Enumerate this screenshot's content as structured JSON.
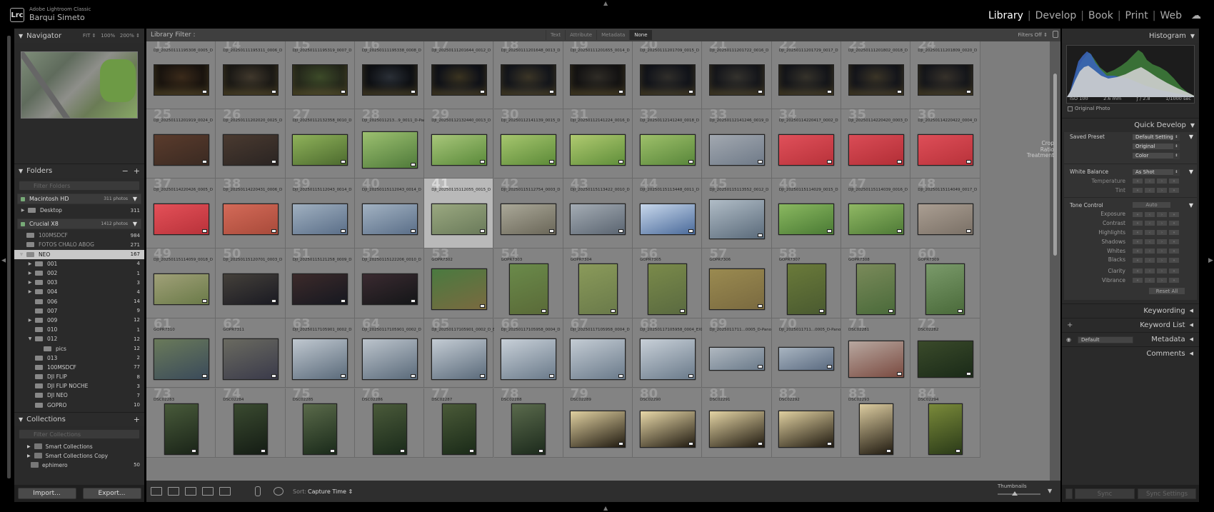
{
  "app": {
    "logo": "Lrc",
    "sub": "Adobe Lightroom Classic",
    "name": "Barqui Simeto"
  },
  "modules": [
    {
      "label": "Library",
      "active": true
    },
    {
      "label": "Develop"
    },
    {
      "label": "Book"
    },
    {
      "label": "Print"
    },
    {
      "label": "Web"
    }
  ],
  "icons": {
    "cloud": "cloud-icon"
  },
  "navigator": {
    "title": "Navigator",
    "zoom": [
      "FIT ⇕",
      "100%",
      "200% ⇕"
    ]
  },
  "folders": {
    "title": "Folders",
    "filter_placeholder": "Filter Folders",
    "volumes": [
      {
        "name": "Macintosh HD",
        "count": "311 photos"
      },
      {
        "name": "Crucial X8",
        "count": "1412 photos"
      }
    ],
    "desktop": {
      "name": "Desktop",
      "count": "311"
    },
    "items": [
      {
        "name": "100MSDCF",
        "count": "984",
        "depth": 0,
        "dim": true
      },
      {
        "name": "FOTOS CHALO ABOG",
        "count": "271",
        "depth": 0,
        "dim": true
      },
      {
        "name": "NEO",
        "count": "167",
        "depth": 0,
        "selected": true,
        "expanded": true
      },
      {
        "name": "001",
        "count": "4",
        "depth": 1,
        "tri": true
      },
      {
        "name": "002",
        "count": "1",
        "depth": 1,
        "tri": true
      },
      {
        "name": "003",
        "count": "3",
        "depth": 1,
        "tri": true
      },
      {
        "name": "004",
        "count": "4",
        "depth": 1,
        "tri": true
      },
      {
        "name": "006",
        "count": "14",
        "depth": 1
      },
      {
        "name": "007",
        "count": "9",
        "depth": 1
      },
      {
        "name": "009",
        "count": "12",
        "depth": 1,
        "tri": true
      },
      {
        "name": "010",
        "count": "1",
        "depth": 1
      },
      {
        "name": "012",
        "count": "12",
        "depth": 1,
        "expanded": true
      },
      {
        "name": "pics",
        "count": "12",
        "depth": 2
      },
      {
        "name": "013",
        "count": "2",
        "depth": 1
      },
      {
        "name": "100MSDCF",
        "count": "77",
        "depth": 1
      },
      {
        "name": "DJI FLIP",
        "count": "8",
        "depth": 1
      },
      {
        "name": "DJI FLIP NOCHE",
        "count": "3",
        "depth": 1
      },
      {
        "name": "DJI NEO",
        "count": "7",
        "depth": 1
      },
      {
        "name": "GOPRO",
        "count": "10",
        "depth": 1
      }
    ]
  },
  "collections": {
    "title": "Collections",
    "filter_placeholder": "Filter Collections",
    "items": [
      {
        "name": "Smart Collections",
        "count": ""
      },
      {
        "name": "Smart Collections Copy",
        "count": ""
      },
      {
        "name": "ephimero",
        "count": "50"
      }
    ]
  },
  "left_buttons": {
    "import": "Import...",
    "export": "Export..."
  },
  "library_filter": {
    "label": "Library Filter :",
    "modes": [
      "Text",
      "Attribute",
      "Metadata",
      "None"
    ],
    "active": "None",
    "status": "Filters Off ⇕"
  },
  "grid_rows": [
    [
      [
        "13",
        "DJI_20250111195308_0005_D"
      ],
      [
        "14",
        "DJI_20250111195311_0006_D"
      ],
      [
        "15",
        "DJI_20250111195319_0007_D"
      ],
      [
        "16",
        "DJI_20250111195338_0008_D"
      ],
      [
        "17",
        "DJI_20250111201644_0012_D"
      ],
      [
        "18",
        "DJI_20250111201648_0013_D"
      ],
      [
        "19",
        "DJI_20250111201655_0014_D"
      ],
      [
        "20",
        "DJI_20250111201709_0015_D"
      ],
      [
        "21",
        "DJI_20250111201722_0016_D"
      ],
      [
        "22",
        "DJI_20250111201729_0017_D"
      ],
      [
        "23",
        "DJI_20250111201802_0018_D"
      ],
      [
        "24",
        "DJI_20250111201809_0020_D"
      ]
    ],
    [
      [
        "25",
        "DJI_20250111201919_0024_D"
      ],
      [
        "26",
        "DJI_20250111202020_0025_D"
      ],
      [
        "27",
        "DJI_20250112132358_0010_D"
      ],
      [
        "28",
        "DJI_2025011213...9_0011_D-Pano"
      ],
      [
        "29",
        "DJI_20250112132440_0013_D"
      ],
      [
        "30",
        "DJI_20250112141139_0015_D"
      ],
      [
        "31",
        "DJI_20250112141224_0016_D"
      ],
      [
        "32",
        "DJI_20250112141240_0018_D"
      ],
      [
        "33",
        "DJI_20250112141246_0019_D"
      ],
      [
        "34",
        "DJI_20250114220417_0002_D"
      ],
      [
        "35",
        "DJI_20250114220420_0003_D"
      ],
      [
        "36",
        "DJI_20250114220422_0004_D"
      ]
    ],
    [
      [
        "37",
        "DJI_20250114220426_0005_D"
      ],
      [
        "38",
        "DJI_20250114220431_0006_D"
      ],
      [
        "39",
        "DJI_20250115112043_0014_D"
      ],
      [
        "40",
        "DJI_20250115112043_0014_D"
      ],
      [
        "41",
        "DJI_20250115112055_0015_D"
      ],
      [
        "42",
        "DJI_20250115112754_0003_D"
      ],
      [
        "43",
        "DJI_20250115113422_0010_D"
      ],
      [
        "44",
        "DJI_20250115113448_0011_D"
      ],
      [
        "45",
        "DJI_20250115113552_0012_D"
      ],
      [
        "46",
        "DJI_20250115114029_0015_D"
      ],
      [
        "47",
        "DJI_20250115114039_0016_D"
      ],
      [
        "48",
        "DJI_20250115114049_0017_D"
      ]
    ],
    [
      [
        "49",
        "DJI_20250115114059_0018_D"
      ],
      [
        "50",
        "DJI_20250115120701_0003_D"
      ],
      [
        "51",
        "DJI_20250115121258_0009_D"
      ],
      [
        "52",
        "DJI_20250115122206_0010_D"
      ],
      [
        "53",
        "GOPR7302"
      ],
      [
        "54",
        "GOPR7303"
      ],
      [
        "55",
        "GOPR7304"
      ],
      [
        "56",
        "GOPR7305"
      ],
      [
        "57",
        "GOPR7306"
      ],
      [
        "58",
        "GOPR7307"
      ],
      [
        "59",
        "GOPR7308"
      ],
      [
        "60",
        "GOPR7309"
      ]
    ],
    [
      [
        "61",
        "GOPR7310"
      ],
      [
        "62",
        "GOPR7311"
      ],
      [
        "63",
        "DJI_20250117105901_0002_D"
      ],
      [
        "64",
        "DJI_20250117105901_0002_D"
      ],
      [
        "65",
        "DJI_20250117105901_0002_D_EXIT"
      ],
      [
        "66",
        "DJI_20250117105958_0004_D"
      ],
      [
        "67",
        "DJI_20250117105958_0004_D"
      ],
      [
        "68",
        "DJI_20250117105958_0004_EXIT"
      ],
      [
        "69",
        "DJI_2025011711...0005_D-Pano"
      ],
      [
        "70",
        "DJI_2025011711...0005_D-Pano"
      ],
      [
        "71",
        "DSC02281"
      ],
      [
        "72",
        "DSC02282"
      ]
    ],
    [
      [
        "73",
        "DSC02283"
      ],
      [
        "74",
        "DSC02284"
      ],
      [
        "75",
        "DSC02285"
      ],
      [
        "76",
        "DSC02286"
      ],
      [
        "77",
        "DSC02287"
      ],
      [
        "78",
        "DSC02288"
      ],
      [
        "79",
        "DSC02289"
      ],
      [
        "80",
        "DSC02290"
      ],
      [
        "81",
        "DSC02291"
      ],
      [
        "82",
        "DSC02292"
      ],
      [
        "83",
        "DSC02293"
      ],
      [
        "84",
        "DSC02294"
      ]
    ]
  ],
  "selected_cell": "41",
  "toolbar": {
    "sort_label": "Sort:",
    "sort_value": "Capture Time ⇕",
    "thumbs_label": "Thumbnails"
  },
  "histogram": {
    "title": "Histogram",
    "iso": "ISO 100",
    "focal": "2.6 mm",
    "aperture": "ƒ / 2.8",
    "shutter": "1/1000 sec",
    "original": "Original Photo"
  },
  "quick_develop": {
    "title": "Quick Develop",
    "saved_preset": {
      "label": "Saved Preset",
      "value": "Default Settings"
    },
    "crop": {
      "label": "Crop Ratio",
      "value": "Original"
    },
    "treatment": {
      "label": "Treatment",
      "value": "Color"
    },
    "wb": {
      "label": "White Balance",
      "value": "As Shot"
    },
    "wb_adj": [
      "Temperature",
      "Tint"
    ],
    "tone": {
      "label": "Tone Control",
      "auto": "Auto"
    },
    "tone_adj": [
      "Exposure",
      "Contrast",
      "Highlights",
      "Shadows",
      "Whites",
      "Blacks"
    ],
    "presence_adj": [
      "Clarity",
      "Vibrance"
    ],
    "reset": "Reset All"
  },
  "right_sections": {
    "keywording": "Keywording",
    "keyword_list": "Keyword List",
    "metadata": "Metadata",
    "metadata_preset": "Default",
    "comments": "Comments"
  },
  "sync": {
    "sync": "Sync",
    "sync_settings": "Sync Settings"
  }
}
